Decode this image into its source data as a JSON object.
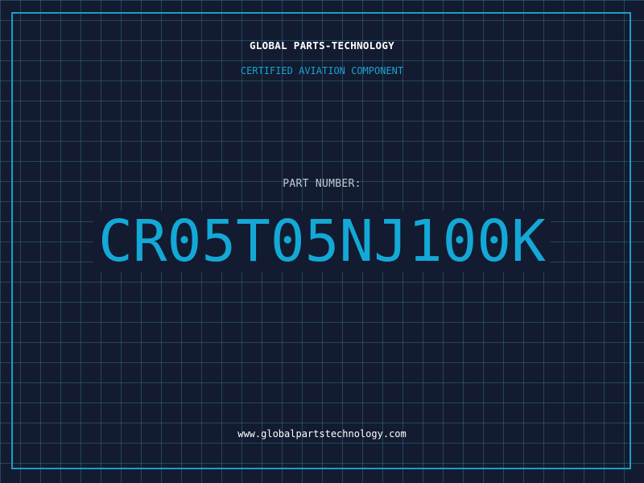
{
  "company_name": "GLOBAL PARTS-TECHNOLOGY",
  "tagline": "CERTIFIED AVIATION COMPONENT",
  "part_number_label": "PART NUMBER:",
  "part_number": "CR05T05NJ100K",
  "website": "www.globalpartstechnology.com",
  "colors": {
    "background": "#121b30",
    "grid": "#3c7896",
    "accent": "#1a9ec9",
    "text": "#ffffff"
  }
}
